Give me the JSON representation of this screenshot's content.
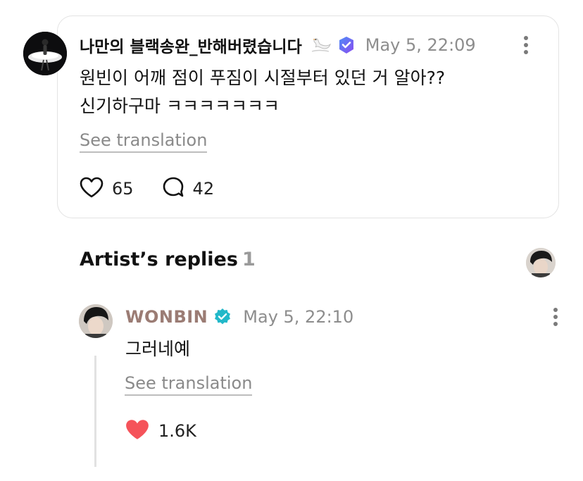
{
  "post": {
    "author": "나만의 블랙송완_반해버렸습니다",
    "timestamp": "May 5, 22:09",
    "body_line1": "원빈이 어깨 점이 푸짐이 시절부터 있던 거 알아??",
    "body_line2": "신기하구마 ㅋㅋㅋㅋㅋㅋㅋ",
    "translate_label": "See translation",
    "likes": "65",
    "comments": "42",
    "icons": {
      "badge": "swan-icon",
      "verified": "fan-verified-icon",
      "like": "heart-outline-icon",
      "comment": "comment-bubble-icon",
      "more": "more-vertical-icon"
    }
  },
  "artist_replies": {
    "title": "Artist’s replies",
    "count": "1"
  },
  "reply": {
    "author": "WONBIN",
    "timestamp": "May 5, 22:10",
    "body": "그러네예",
    "translate_label": "See translation",
    "likes": "1.6K",
    "icons": {
      "verified": "artist-verified-icon",
      "like": "heart-filled-icon",
      "more": "more-vertical-icon"
    }
  },
  "colors": {
    "artist_name": "#9b7c74",
    "artist_badge": "#22b8c9",
    "heart_filled": "#f5535a",
    "fan_badge": "#6b63f0",
    "muted_text": "#8d8d8d"
  }
}
